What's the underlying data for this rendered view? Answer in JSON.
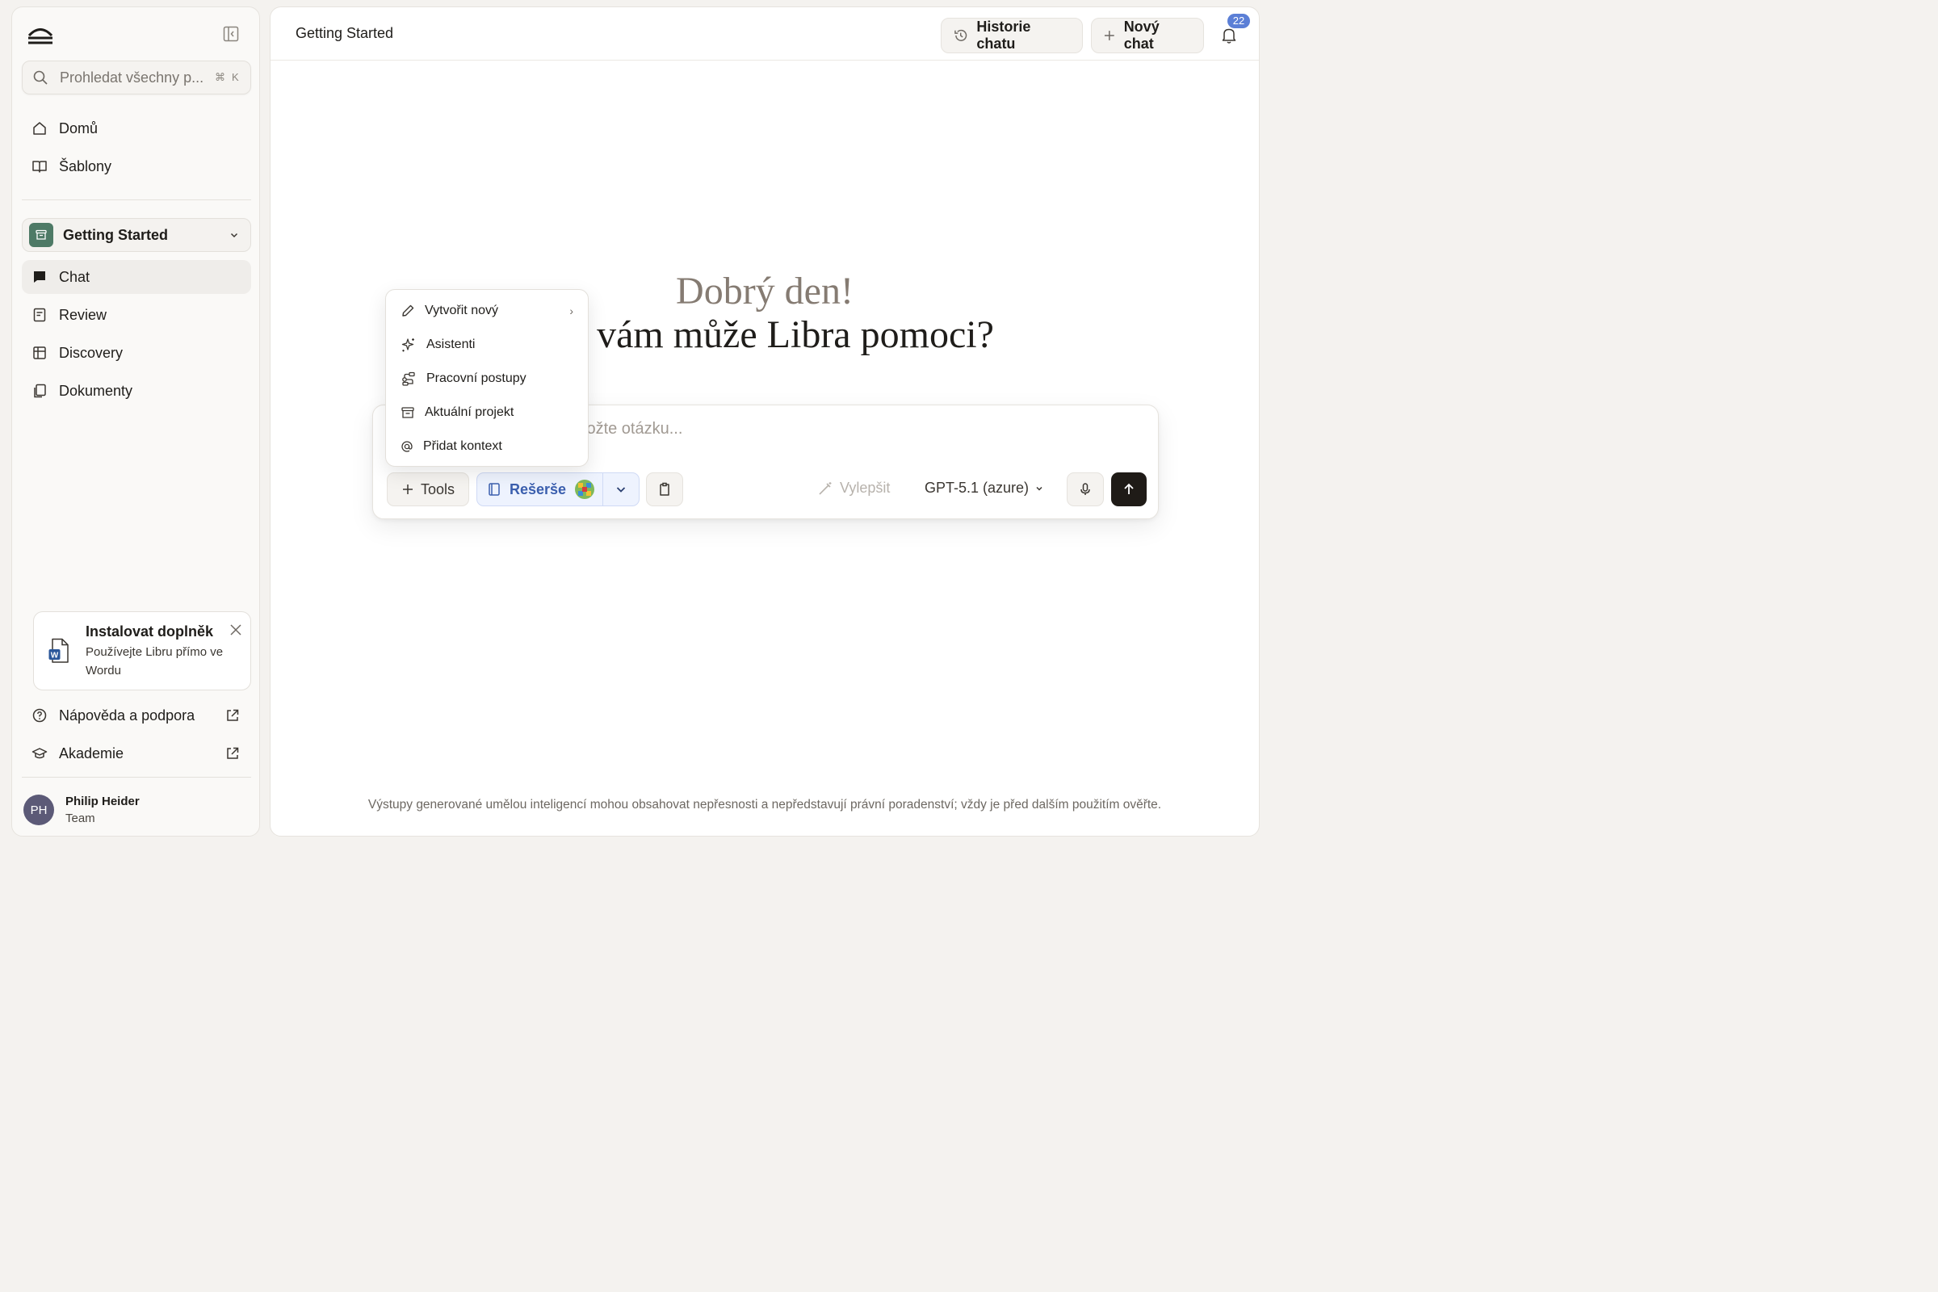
{
  "sidebar": {
    "search_placeholder": "Prohledat všechny p...",
    "shortcut_cmd": "⌘",
    "shortcut_key": "K",
    "nav_top": [
      {
        "label": "Domů",
        "icon": "home-icon"
      },
      {
        "label": "Šablony",
        "icon": "book-icon"
      }
    ],
    "project_name": "Getting Started",
    "nav_project": [
      {
        "label": "Chat",
        "icon": "chat-icon"
      },
      {
        "label": "Review",
        "icon": "review-icon"
      },
      {
        "label": "Discovery",
        "icon": "table-icon"
      },
      {
        "label": "Dokumenty",
        "icon": "documents-icon"
      }
    ],
    "addon": {
      "title": "Instalovat doplněk",
      "desc": "Používejte Libru přímo ve Wordu"
    },
    "nav_bottom": [
      {
        "label": "Nápověda a podpora",
        "icon": "help-icon"
      },
      {
        "label": "Akademie",
        "icon": "graduation-cap-icon"
      }
    ],
    "user": {
      "initials": "PH",
      "name": "Philip Heider",
      "role": "Team"
    }
  },
  "header": {
    "title": "Getting Started",
    "history_label": "Historie chatu",
    "new_chat_label": "Nový chat",
    "notifications_count": "22"
  },
  "greeting": {
    "line1": "Dobrý den!",
    "line2_visible": "vám může Libra pomoci?"
  },
  "composer": {
    "placeholder_visible": "ložte otázku...",
    "tools_label": "Tools",
    "research_label": "Rešerše",
    "improve_label": "Vylepšit",
    "model_label": "GPT-5.1 (azure)"
  },
  "menu": {
    "items": [
      {
        "label": "Vytvořit nový",
        "icon": "pencil-icon",
        "has_submenu": true
      },
      {
        "label": "Asistenti",
        "icon": "sparkles-icon",
        "has_submenu": false
      },
      {
        "label": "Pracovní postupy",
        "icon": "workflow-icon",
        "has_submenu": false
      },
      {
        "label": "Aktuální projekt",
        "icon": "archive-icon",
        "has_submenu": false
      },
      {
        "label": "Přidat kontext",
        "icon": "at-icon",
        "has_submenu": false
      }
    ],
    "submenu_arrow": "›"
  },
  "disclaimer": "Výstupy generované umělou inteligencí mohou obsahovat nepřesnosti a nepředstavují právní poradenství; vždy je před dalším použitím ověřte.",
  "colors": {
    "accent_blue": "#3b5fae",
    "badge_blue": "#5b7fd6",
    "project_green": "#4e7a66",
    "send_dark": "#1f1b17"
  }
}
